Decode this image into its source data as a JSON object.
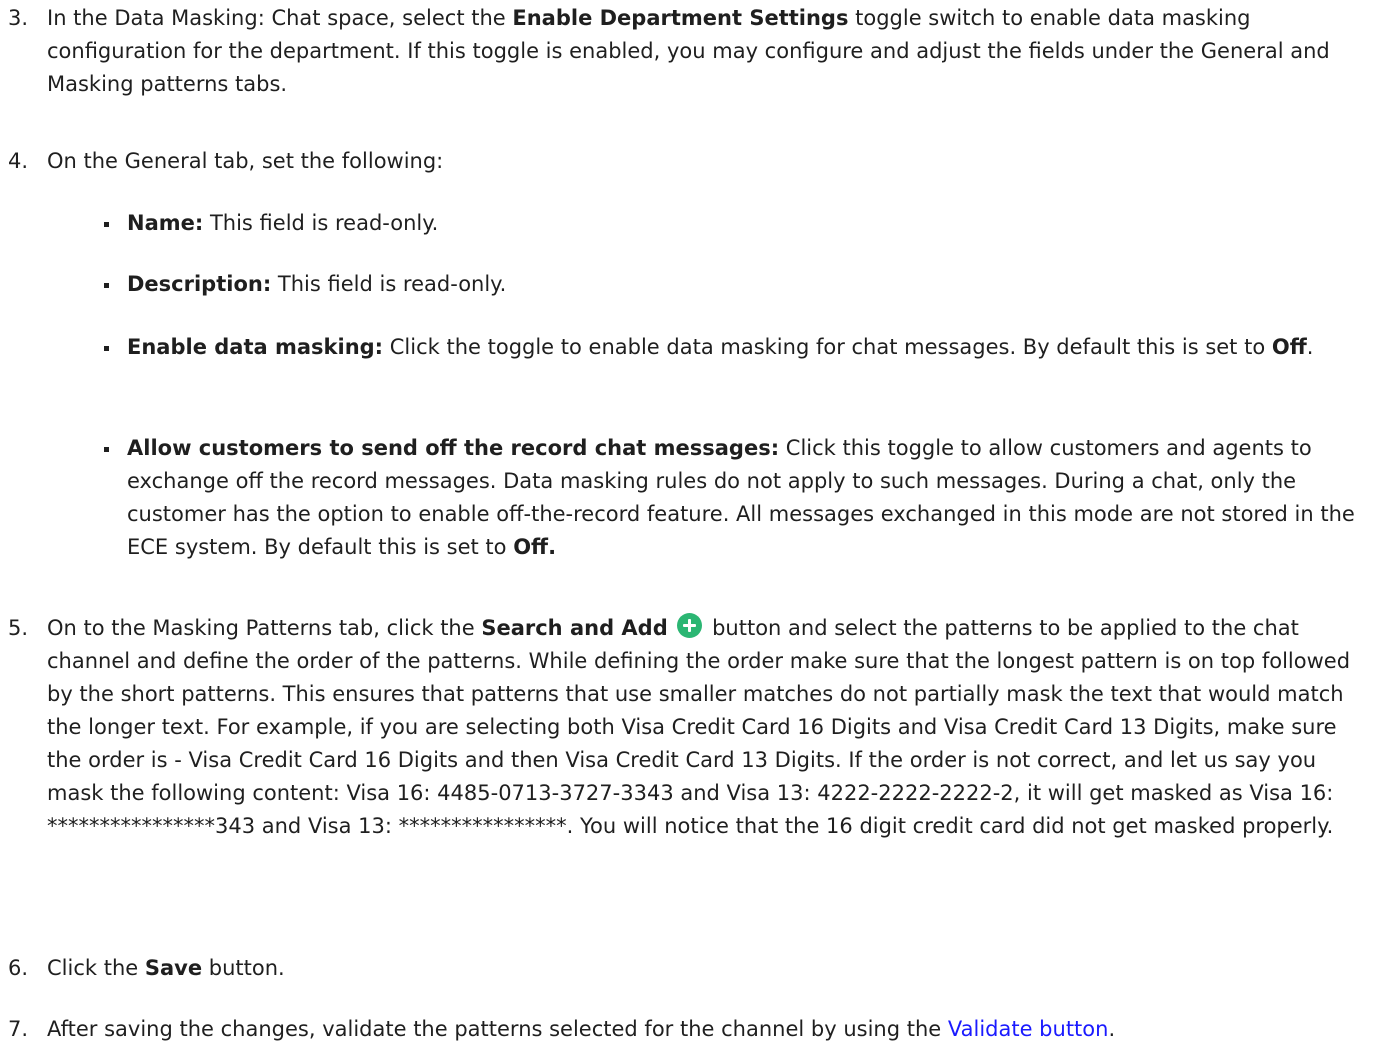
{
  "steps": {
    "s3": {
      "num": "3.",
      "t1": "In the Data Masking: Chat space, select the ",
      "b1": "Enable Department Settings",
      "t2": " toggle switch to enable data masking configuration for the department. If this toggle is enabled, you may configure and adjust the fields under the General and Masking patterns tabs."
    },
    "s4": {
      "num": "4.",
      "text": "On the General tab, set the following:",
      "bullets": [
        {
          "label": "Name:",
          "text": " This field is read-only."
        },
        {
          "label": "Description:",
          "text": " This field is read-only."
        },
        {
          "label": "Enable data masking:",
          "text": " Click the toggle to enable data masking for chat messages. By default this is set to ",
          "bold_end": "Off",
          "tail": "."
        },
        {
          "label": "Allow customers to send off the record chat messages:",
          "text": " Click this toggle to allow customers and agents to exchange off the record messages. Data masking rules do not apply to such messages. During a chat, only the customer has the option to enable off-the-record feature. All messages exchanged in this mode are not stored in the ECE system. By default this is set to ",
          "bold_end": "Off."
        }
      ]
    },
    "s5": {
      "num": "5.",
      "t1": "On to the Masking Patterns tab, click the ",
      "b1": "Search and Add",
      "icon": "plus-circle-icon",
      "t2": " button and select the patterns to be applied to the chat channel and define the order of the patterns. While defining the order make sure that the longest pattern is on top followed by the short patterns. This ensures that patterns that use smaller matches do not partially mask the text that would match the longer text. For example, if you are selecting both Visa Credit Card 16 Digits and Visa Credit Card 13 Digits, make sure the order is - Visa Credit Card 16 Digits and then Visa Credit Card 13 Digits. If the order is not correct, and let us say you mask the following content: Visa 16: 4485-0713-3727-3343 and Visa 13: 4222-2222-2222-2, it will get masked as Visa 16: ****************343 and Visa 13: ****************. You will notice that the 16 digit credit card did not get masked properly."
    },
    "s6": {
      "num": "6.",
      "t1": "Click the ",
      "b1": "Save",
      "t2": " button."
    },
    "s7": {
      "num": "7.",
      "t1": "After saving the changes, validate the patterns selected for the channel by using the ",
      "link": "Validate button",
      "t2": "."
    }
  },
  "colors": {
    "text": "#1f1f1f",
    "link": "#1a1aff",
    "icon_green": "#2bb673"
  }
}
